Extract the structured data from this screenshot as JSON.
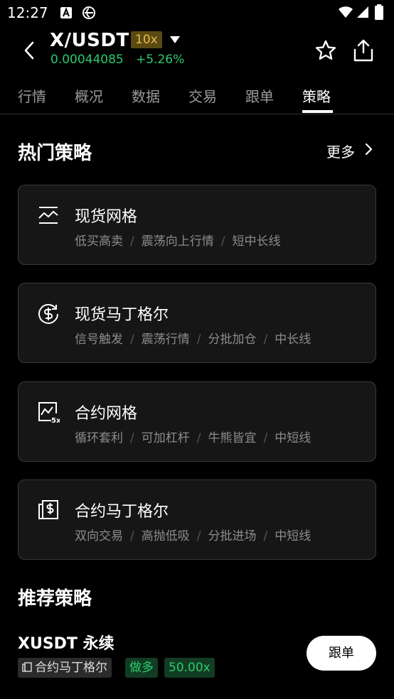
{
  "status_bar": {
    "time": "12:27"
  },
  "header": {
    "pair": "X/USDT",
    "leverage": "10x",
    "price": "0.00044085",
    "change": "+5.26%"
  },
  "tabs": [
    {
      "label": "行情"
    },
    {
      "label": "概况"
    },
    {
      "label": "数据"
    },
    {
      "label": "交易"
    },
    {
      "label": "跟单"
    },
    {
      "label": "策略"
    }
  ],
  "hot": {
    "title": "热门策略",
    "more": "更多",
    "cards": [
      {
        "title": "现货网格",
        "tags": [
          "低买高卖",
          "震荡向上行情",
          "短中长线"
        ],
        "icon": "grid-chart-icon"
      },
      {
        "title": "现货马丁格尔",
        "tags": [
          "信号触发",
          "震荡行情",
          "分批加仓",
          "中长线"
        ],
        "icon": "dollar-cycle-icon"
      },
      {
        "title": "合约网格",
        "tags": [
          "循环套利",
          "可加杠杆",
          "牛熊皆宜",
          "中短线"
        ],
        "icon": "contract-grid-5x-icon"
      },
      {
        "title": "合约马丁格尔",
        "tags": [
          "双向交易",
          "高抛低吸",
          "分批进场",
          "中短线"
        ],
        "icon": "contract-dollar-icon"
      }
    ]
  },
  "recommended": {
    "title": "推荐策略",
    "item": {
      "name": "XUSDT 永续",
      "type": "合约马丁格尔",
      "direction": "做多",
      "leverage": "50.00x",
      "button": "跟单"
    }
  }
}
